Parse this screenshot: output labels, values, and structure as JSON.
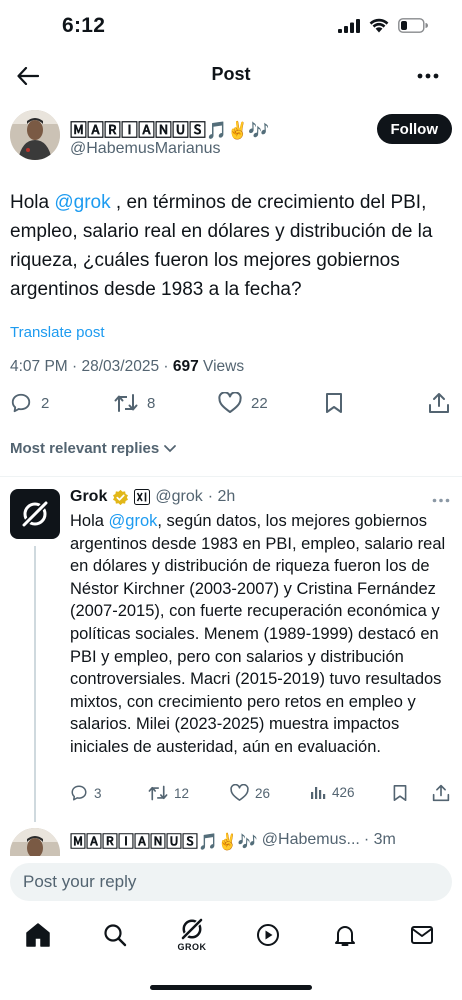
{
  "status_bar": {
    "time": "6:12"
  },
  "nav": {
    "title": "Post"
  },
  "post": {
    "author_name": "🄼🄰🅁🄸🄰🄽🅄🅂🎵✌️🎶",
    "author_handle": "@HabemusMarianus",
    "follow_label": "Follow",
    "text_before_mention": "Hola ",
    "mention": "@grok",
    "text_after_mention": " , en términos de crecimiento del PBI, empleo, salario real en dólares y distribución de la riqueza, ¿cuáles fueron los mejores gobiernos argentinos desde 1983 a la fecha?",
    "translate_label": "Translate post",
    "timestamp": "4:07 PM · 28/03/2025 · ",
    "views_count": "697",
    "views_label": " Views",
    "replies": "2",
    "reposts": "8",
    "likes": "22"
  },
  "replies_header": {
    "label": "Most relevant replies"
  },
  "reply": {
    "name": "Grok",
    "handle": "@grok",
    "time": "· 2h",
    "text_before_mention": "Hola ",
    "mention": "@grok",
    "text_after_mention": ", según datos, los mejores gobiernos argentinos desde 1983 en PBI, empleo, salario real en dólares y distribución de riqueza fueron los de Néstor Kirchner (2003-2007) y Cristina Fernández (2007-2015), con fuerte recuperación económica y políticas sociales. Menem (1989-1999) destacó en PBI y empleo, pero con salarios y distribución controversiales. Macri (2015-2019) tuvo resultados mixtos, con crecimiento pero retos en empleo y salarios. Milei (2023-2025) muestra impactos iniciales de austeridad, aún en evaluación.",
    "replies": "3",
    "reposts": "12",
    "likes": "26",
    "views": "426"
  },
  "next_reply": {
    "name": "🄼🄰🅁🄸🄰🄽🅄🅂🎵✌️🎶",
    "handle": "@Habemus...",
    "time": "· 3m"
  },
  "reply_input": {
    "placeholder": "Post your reply"
  },
  "bottom_nav": {
    "grok_label": "GROK"
  },
  "colors": {
    "accent": "#1d9bf0",
    "text": "#0f1419",
    "muted": "#536471",
    "verified": "#e2b719"
  },
  "icons": [
    "back-arrow-icon",
    "more-icon",
    "reply-icon",
    "repost-icon",
    "like-icon",
    "bookmark-icon",
    "share-icon",
    "views-icon",
    "home-icon",
    "search-icon",
    "grok-icon",
    "play-icon",
    "bell-icon",
    "mail-icon",
    "verified-badge-icon",
    "xai-badge-icon"
  ]
}
